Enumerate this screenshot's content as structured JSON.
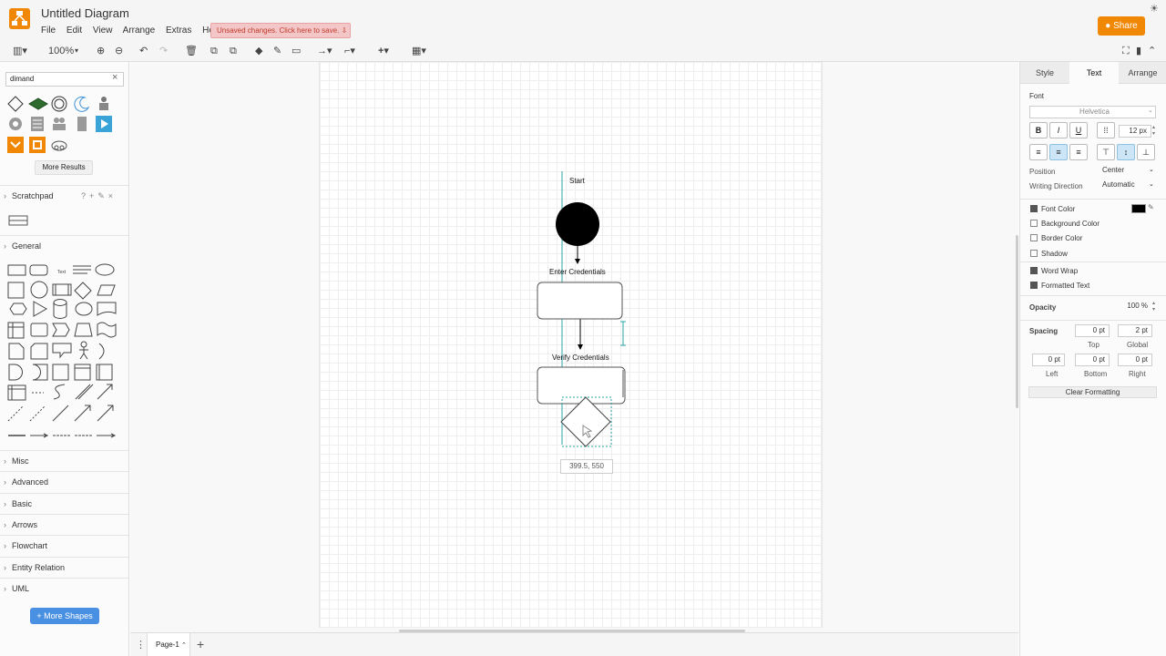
{
  "app": {
    "title": "Untitled Diagram",
    "menu": [
      "File",
      "Edit",
      "View",
      "Arrange",
      "Extras",
      "Help"
    ],
    "unsaved_notice": "Unsaved changes. Click here to save.",
    "share_label": "Share",
    "colors": {
      "brand": "#f08705",
      "accent": "#4a90e2",
      "notice_bg": "#f3c7c7"
    }
  },
  "toolbar": {
    "zoom": "100%"
  },
  "sidebar": {
    "search_value": "dimand",
    "more_results": "More Results",
    "scratchpad": "Scratchpad",
    "general": "General",
    "sections": [
      "Misc",
      "Advanced",
      "Basic",
      "Arrows",
      "Flowchart",
      "Entity Relation",
      "UML"
    ],
    "more_shapes": "More Shapes"
  },
  "canvas": {
    "labels": {
      "start": "Start",
      "enter": "Enter Credentials",
      "verify": "Verify Credentials"
    },
    "coordinate_tooltip": "399.5, 550"
  },
  "bottom": {
    "page_tab": "Page-1"
  },
  "format_panel": {
    "tabs": [
      "Style",
      "Text",
      "Arrange"
    ],
    "active_tab": "Text",
    "font_label": "Font",
    "font_family": "Helvetica",
    "font_size": "12 px",
    "position_label": "Position",
    "position_value": "Center",
    "writing_direction_label": "Writing Direction",
    "writing_direction_value": "Automatic",
    "font_color": "Font Color",
    "background_color": "Background Color",
    "border_color": "Border Color",
    "shadow": "Shadow",
    "word_wrap": "Word Wrap",
    "formatted_text": "Formatted Text",
    "opacity_label": "Opacity",
    "opacity_value": "100 %",
    "spacing_label": "Spacing",
    "top_value": "0 pt",
    "global_value": "2 pt",
    "top_label": "Top",
    "global_label": "Global",
    "left_value": "0 pt",
    "bottom_value": "0 pt",
    "right_value": "0 pt",
    "left_label": "Left",
    "bottom_label": "Bottom",
    "right_label": "Right",
    "clear_formatting": "Clear Formatting"
  }
}
